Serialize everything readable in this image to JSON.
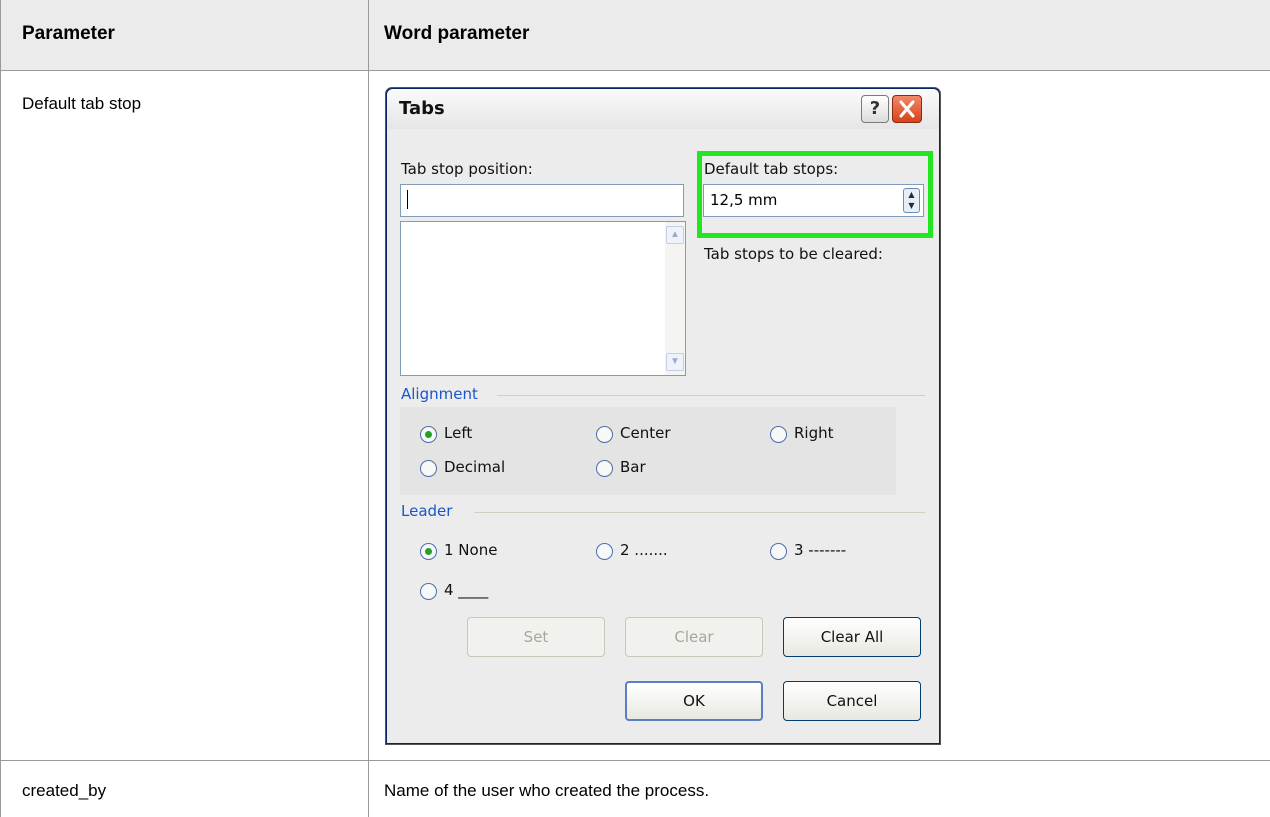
{
  "table": {
    "headers": [
      "Parameter",
      "Word parameter"
    ],
    "rows": [
      {
        "parameter": "Default tab stop",
        "value": ""
      },
      {
        "parameter": "created_by",
        "value": "Name of the user who created the process."
      }
    ]
  },
  "dialog": {
    "title": "Tabs",
    "help_label": "?",
    "tab_stop_position_label": "Tab stop position:",
    "tab_stop_position_value": "",
    "default_tab_stops_label": "Default tab stops:",
    "default_tab_stops_value": "12,5 mm",
    "tab_stops_cleared_label": "Tab stops to be cleared:",
    "alignment_label": "Alignment",
    "alignment_options": [
      "Left",
      "Center",
      "Right",
      "Decimal",
      "Bar"
    ],
    "alignment_selected": "Left",
    "leader_label": "Leader",
    "leader_options": [
      "1 None",
      "2 .......",
      "3 -------",
      "4 ____"
    ],
    "leader_selected": "1 None",
    "buttons": {
      "set": "Set",
      "clear": "Clear",
      "clear_all": "Clear All",
      "ok": "OK",
      "cancel": "Cancel"
    }
  },
  "colors": {
    "highlight": "#22e622",
    "group_label": "#1c55c8"
  }
}
